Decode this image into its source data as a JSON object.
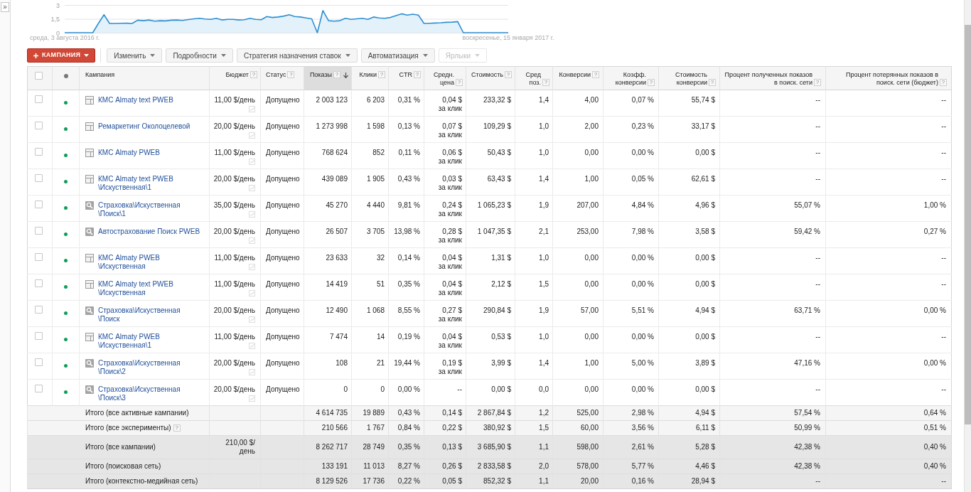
{
  "sidebar": {
    "toggle": "»"
  },
  "chart": {
    "start_label": "среда, 3 августа 2016 г.",
    "end_label": "воскресенье, 15 января 2017 г.",
    "chart_data": {
      "type": "area",
      "values": [
        0,
        0,
        0,
        0,
        0,
        0,
        1.0,
        1.95,
        1.0,
        1.0,
        1.02,
        1.03,
        1.0,
        1.35,
        1.3,
        1.38,
        1.25,
        1.3,
        1.28,
        1.35,
        1.38,
        1.32,
        1.42,
        1.5,
        1.55,
        1.48,
        1.45,
        1.55,
        1.38,
        1.45,
        1.45,
        1.38,
        1.4,
        1.55,
        1.45,
        1.4,
        1.75,
        1.65,
        1.7,
        1.8,
        1.95,
        1.75,
        1.7,
        1.6,
        1.5,
        0,
        2.4,
        1.3,
        1.25,
        1.3,
        1.55,
        1.45,
        1.5,
        1.55,
        1.45,
        1.7,
        1.6,
        1.55,
        1.65,
        1.85,
        2.05,
        1.9,
        2.0,
        1.9,
        1.0,
        1.02,
        1.05,
        1.08,
        1.12,
        1.15,
        1.2,
        0,
        0,
        0,
        0,
        0,
        0,
        0,
        0,
        0
      ],
      "ylim": [
        0,
        3
      ],
      "yticks": [
        {
          "value": 0,
          "label": "0"
        },
        {
          "value": 1.5,
          "label": "1,5"
        },
        {
          "value": 3,
          "label": "3"
        }
      ]
    }
  },
  "toolbar": {
    "create_button": "КАМПАНИЯ",
    "buttons": [
      {
        "label": "Изменить",
        "disabled": false
      },
      {
        "label": "Подробности",
        "disabled": false
      },
      {
        "label": "Стратегия назначения ставок",
        "disabled": false
      },
      {
        "label": "Автоматизация",
        "disabled": false
      },
      {
        "label": "Ярлыки",
        "disabled": true
      }
    ]
  },
  "table": {
    "header_checkbox": {
      "checked": false
    },
    "columns": [
      {
        "label": "Кампания",
        "sorted": false
      },
      {
        "label": "Бюджет",
        "help": "?",
        "sorted": false
      },
      {
        "label": "Статус",
        "help": "?",
        "sorted": false
      },
      {
        "label": "Показы",
        "help": "?",
        "sorted": true
      },
      {
        "label": "Клики",
        "help": "?",
        "sorted": false
      },
      {
        "label": "CTR",
        "help": "?",
        "sorted": false
      },
      {
        "label": "Средн. цена",
        "help": "?",
        "sorted": false
      },
      {
        "label": "Стоимость",
        "help": "?",
        "sorted": false
      },
      {
        "label": "Сред поз.",
        "help": "?",
        "sorted": false
      },
      {
        "label": "Конверсии",
        "help": "?",
        "sorted": false
      },
      {
        "label": "Коэфф. конверсии",
        "help": "?",
        "sorted": false
      },
      {
        "label": "Стоимость конверсии",
        "help": "?",
        "sorted": false
      },
      {
        "label": "Процент полученных показов в поиск. сети",
        "help": "?",
        "sorted": false
      },
      {
        "label": "Процент потерянных показов в поиск. сети (бюджет)",
        "help": "?",
        "sorted": false
      }
    ],
    "rows": [
      {
        "checked": false,
        "color": "#0f9d58",
        "kind": "display",
        "name": "КМС Almaty text PWEB",
        "budget": "11,00 $/день",
        "status": "Допущено",
        "metrics": [
          "2 003 123",
          "6 203",
          "0,31 %",
          "0,04 $",
          "233,32 $",
          "1,4",
          "4,00",
          "0,07 %",
          "55,74 $",
          "--",
          "--"
        ],
        "cpc_note": "за клик"
      },
      {
        "checked": false,
        "color": "#0f9d58",
        "kind": "display",
        "name": "Ремаркетинг Околоцелевой",
        "budget": "20,00 $/день",
        "status": "Допущено",
        "metrics": [
          "1 273 998",
          "1 598",
          "0,13 %",
          "0,07 $",
          "109,29 $",
          "1,0",
          "2,00",
          "0,23 %",
          "33,17 $",
          "--",
          "--"
        ],
        "cpc_note": "за клик"
      },
      {
        "checked": false,
        "color": "#0f9d58",
        "kind": "display",
        "name": "КМС Almaty PWEB",
        "budget": "11,00 $/день",
        "status": "Допущено",
        "metrics": [
          "768 624",
          "852",
          "0,11 %",
          "0,06 $",
          "50,43 $",
          "1,0",
          "0,00",
          "0,00 %",
          "0,00 $",
          "--",
          "--"
        ],
        "cpc_note": "за клик"
      },
      {
        "checked": false,
        "color": "#0f9d58",
        "kind": "display",
        "name": "КМС Almaty text PWEB\\Искуственная\\1",
        "budget": "20,00 $/день",
        "status": "Допущено",
        "metrics": [
          "439 089",
          "1 905",
          "0,43 %",
          "0,03 $",
          "63,43 $",
          "1,4",
          "1,00",
          "0,05 %",
          "62,61 $",
          "--",
          "--"
        ],
        "cpc_note": "за клик"
      },
      {
        "checked": false,
        "color": "#0f9d58",
        "kind": "search",
        "name": "Страховка\\Искуственная\\Поиск\\1",
        "budget": "35,00 $/день",
        "status": "Допущено",
        "metrics": [
          "45 270",
          "4 440",
          "9,81 %",
          "0,24 $",
          "1 065,23 $",
          "1,9",
          "207,00",
          "4,84 %",
          "4,96 $",
          "55,07 %",
          "1,00 %"
        ],
        "cpc_note": "за клик"
      },
      {
        "checked": false,
        "color": "#0f9d58",
        "kind": "search",
        "name": "Автострахование Поиск PWEB",
        "budget": "20,00 $/день",
        "status": "Допущено",
        "metrics": [
          "26 507",
          "3 705",
          "13,98 %",
          "0,28 $",
          "1 047,35 $",
          "2,1",
          "253,00",
          "7,98 %",
          "3,58 $",
          "59,42 %",
          "0,27 %"
        ],
        "cpc_note": "за клик"
      },
      {
        "checked": false,
        "color": "#0f9d58",
        "kind": "display",
        "name": "КМС Almaty PWEB\\Искуственная",
        "budget": "11,00 $/день",
        "status": "Допущено",
        "metrics": [
          "23 633",
          "32",
          "0,14 %",
          "0,04 $",
          "1,31 $",
          "1,0",
          "0,00",
          "0,00 %",
          "0,00 $",
          "--",
          "--"
        ],
        "cpc_note": "за клик"
      },
      {
        "checked": false,
        "color": "#0f9d58",
        "kind": "display",
        "name": "КМС Almaty text PWEB\\Искуственная",
        "budget": "11,00 $/день",
        "status": "Допущено",
        "metrics": [
          "14 419",
          "51",
          "0,35 %",
          "0,04 $",
          "2,12 $",
          "1,5",
          "0,00",
          "0,00 %",
          "0,00 $",
          "--",
          "--"
        ],
        "cpc_note": "за клик"
      },
      {
        "checked": false,
        "color": "#0f9d58",
        "kind": "search",
        "name": "Страховка\\Искуственная\\Поиск",
        "budget": "20,00 $/день",
        "status": "Допущено",
        "metrics": [
          "12 490",
          "1 068",
          "8,55 %",
          "0,27 $",
          "290,84 $",
          "1,9",
          "57,00",
          "5,51 %",
          "4,94 $",
          "63,71 %",
          "0,00 %"
        ],
        "cpc_note": "за клик"
      },
      {
        "checked": false,
        "color": "#0f9d58",
        "kind": "display",
        "name": "КМС Almaty PWEB\\Искуственная\\1",
        "budget": "11,00 $/день",
        "status": "Допущено",
        "metrics": [
          "7 474",
          "14",
          "0,19 %",
          "0,04 $",
          "0,53 $",
          "1,0",
          "0,00",
          "0,00 %",
          "0,00 $",
          "--",
          "--"
        ],
        "cpc_note": "за клик"
      },
      {
        "checked": false,
        "color": "#0f9d58",
        "kind": "search",
        "name": "Страховка\\Искуственная\\Поиск\\2",
        "budget": "20,00 $/день",
        "status": "Допущено",
        "metrics": [
          "108",
          "21",
          "19,44 %",
          "0,19 $",
          "3,99 $",
          "1,4",
          "1,00",
          "5,00 %",
          "3,89 $",
          "47,16 %",
          "0,00 %"
        ],
        "cpc_note": "за клик"
      },
      {
        "checked": false,
        "color": "#0f9d58",
        "kind": "search",
        "name": "Страховка\\Искуственная\\Поиск\\3",
        "budget": "20,00 $/день",
        "status": "Допущено",
        "metrics": [
          "0",
          "0",
          "0,00 %",
          "--",
          "0,00 $",
          "0,0",
          "0,00",
          "0,00 %",
          "0,00 $",
          "--",
          "--"
        ]
      }
    ],
    "totals": [
      {
        "kind": "subtotal",
        "label": "Итого (все активные кампании)",
        "metrics": [
          "4 614 735",
          "19 889",
          "0,43 %",
          "0,14 $",
          "2 867,84 $",
          "1,2",
          "525,00",
          "2,98 %",
          "4,94 $",
          "57,54 %",
          "0,64 %"
        ]
      },
      {
        "kind": "subtotal",
        "label": "Итого (все эксперименты)",
        "help": "?",
        "metrics": [
          "210 566",
          "1 767",
          "0,84 %",
          "0,22 $",
          "380,92 $",
          "1,5",
          "60,00",
          "3,56 %",
          "6,11 $",
          "50,99 %",
          "0,51 %"
        ]
      },
      {
        "kind": "total",
        "label": "Итого (все кампании)",
        "budget": "210,00 $/день",
        "metrics": [
          "8 262 717",
          "28 749",
          "0,35 %",
          "0,13 $",
          "3 685,90 $",
          "1,1",
          "598,00",
          "2,61 %",
          "5,28 $",
          "42,38 %",
          "0,40 %"
        ]
      },
      {
        "kind": "total",
        "label": "Итого (поисковая сеть)",
        "metrics": [
          "133 191",
          "11 013",
          "8,27 %",
          "0,26 $",
          "2 833,58 $",
          "2,0",
          "578,00",
          "5,77 %",
          "4,46 $",
          "42,38 %",
          "0,40 %"
        ]
      },
      {
        "kind": "total",
        "label": "Итого (контекстно-медийная сеть)",
        "metrics": [
          "8 129 526",
          "17 736",
          "0,22 %",
          "0,05 $",
          "852,32 $",
          "1,1",
          "20,00",
          "0,16 %",
          "28,94 $",
          "--",
          "--"
        ]
      }
    ]
  }
}
